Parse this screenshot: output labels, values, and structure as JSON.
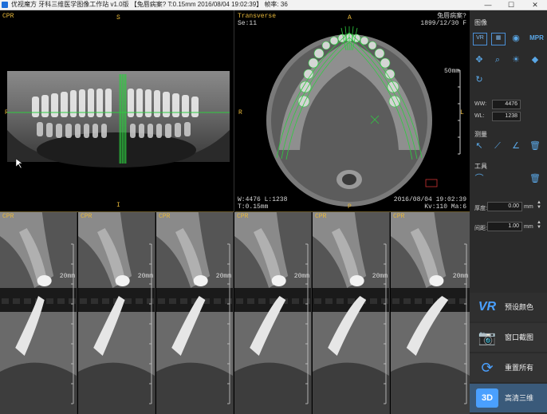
{
  "window": {
    "title": "优视魔方 牙科三维医学图像工作站 v1.0版 【兔唇病案? T:0.15mm 2016/08/04 19:02:39】 帧率: 36",
    "minimize": "—",
    "maximize": "☐",
    "close": "✕"
  },
  "viewports": {
    "cpr": {
      "label": "CPR",
      "orient_top": "S",
      "orient_bottom": "I",
      "orient_left": "R",
      "orient_right": "L"
    },
    "transverse": {
      "label": "Transverse",
      "series": "Se:11",
      "patient": "兔唇病案?",
      "date": "1899/12/30 F",
      "orient_top": "A",
      "orient_bottom": "P",
      "orient_left": "R",
      "orient_right": "L",
      "scale": "50mm",
      "window_level": "W:4476 L:1238",
      "thickness": "T:0.15mm",
      "timestamp": "2016/08/04 19:02:39",
      "kv": "Kv:110 Ma:6"
    }
  },
  "thumbnails": [
    {
      "label": "CPR",
      "scale": "20mm"
    },
    {
      "label": "CPR",
      "scale": "20mm"
    },
    {
      "label": "CPR",
      "scale": "20mm"
    },
    {
      "label": "CPR",
      "scale": "20mm"
    },
    {
      "label": "CPR",
      "scale": "20mm"
    },
    {
      "label": "CPR",
      "scale": "20mm"
    }
  ],
  "panel": {
    "image_section": "图像",
    "vr_label": "VR",
    "mpr_label": "MPR",
    "ww_label": "WW:",
    "ww_value": "4476",
    "wl_label": "WL:",
    "wl_value": "1238",
    "measure_section": "测量",
    "tools_section": "工具",
    "thickness_label": "厚度:",
    "thickness_value": "0.00",
    "interval_label": "间距:",
    "interval_value": "1.00",
    "unit_mm": "mm",
    "preset_color": "预设颜色",
    "window_capture": "窗口截图",
    "reset_all": "重置所有",
    "hd_3d": "高清三维",
    "vr_icon_text": "VR",
    "hd_icon_text": "3D"
  },
  "colors": {
    "accent": "#4aa0ff",
    "overlay_yellow": "#e8b83a",
    "curve_green": "#2ecc40"
  }
}
